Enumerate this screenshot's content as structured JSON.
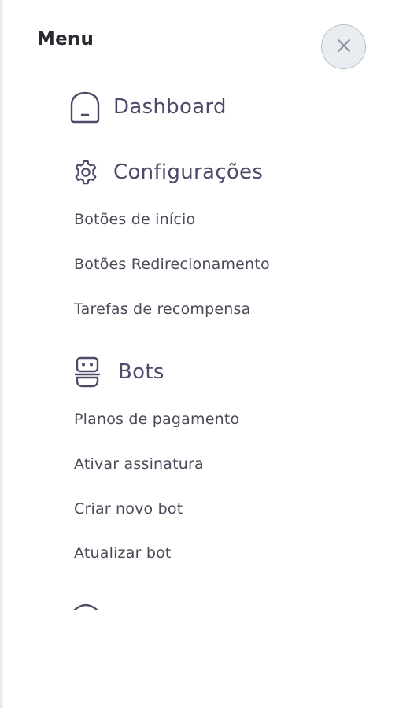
{
  "menu": {
    "title": "Menu",
    "close_icon": "close-icon"
  },
  "nav": {
    "dashboard": {
      "label": "Dashboard",
      "icon": "home-icon"
    },
    "settings": {
      "label": "Configurações",
      "icon": "gear-icon",
      "items": [
        "Botões de início",
        "Botões Redirecionamento",
        "Tarefas de recompensa"
      ]
    },
    "bots": {
      "label": "Bots",
      "icon": "robot-icon",
      "items": [
        "Planos de pagamento",
        "Ativar assinatura",
        "Criar novo bot",
        "Atualizar bot"
      ]
    },
    "next_section_icon": "partial-icon"
  },
  "colors": {
    "section_text": "#4e4a6a",
    "item_text": "#4a4a58",
    "title_text": "#2b2b33",
    "close_bg": "#e9ecf0"
  }
}
